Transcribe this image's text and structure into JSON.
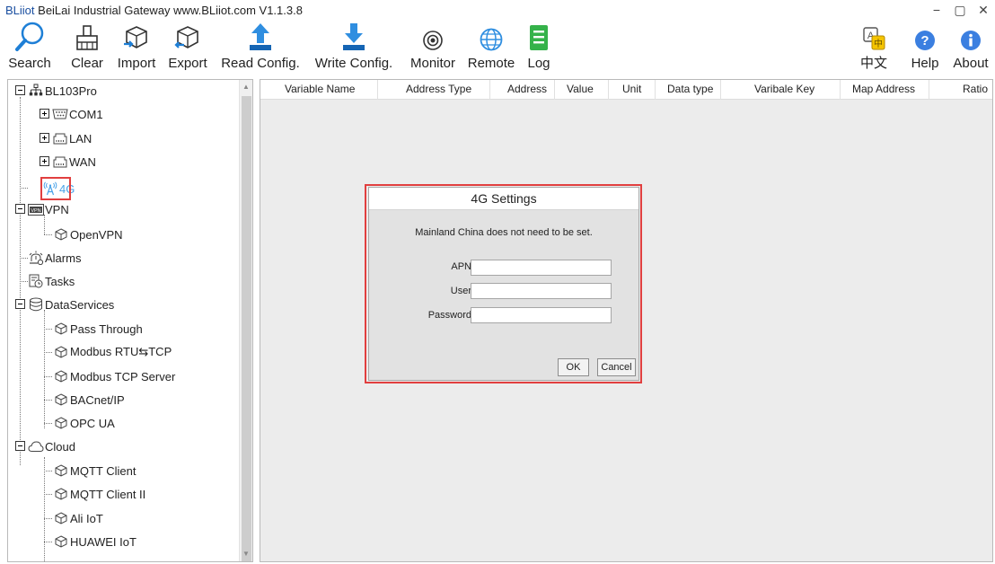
{
  "window": {
    "brand": "BLiiot",
    "title": " BeiLai Industrial Gateway www.BLiiot.com V1.1.3.8",
    "minimize": "−",
    "maximize": "▢",
    "close": "✕"
  },
  "toolbar": {
    "search": "Search",
    "clear": "Clear",
    "import": "Import",
    "export": "Export",
    "read_config": "Read Config.",
    "write_config": "Write Config.",
    "monitor": "Monitor",
    "remote": "Remote",
    "log": "Log",
    "language": "中文",
    "help": "Help",
    "about": "About"
  },
  "tree": {
    "root": "BL103Pro",
    "com1": "COM1",
    "lan": "LAN",
    "wan": "WAN",
    "g4": "4G",
    "vpn": "VPN",
    "openvpn": "OpenVPN",
    "alarms": "Alarms",
    "tasks": "Tasks",
    "data_services": "DataServices",
    "pass_through": "Pass Through",
    "modbus_rtu_tcp": "Modbus RTU⇆TCP",
    "modbus_tcp_server": "Modbus TCP Server",
    "bacnet_ip": "BACnet/IP",
    "opc_ua": "OPC UA",
    "cloud": "Cloud",
    "mqtt_client": "MQTT Client",
    "mqtt_client_2": "MQTT Client II",
    "ali_iot": "Ali IoT",
    "huawei_iot": "HUAWEI IoT"
  },
  "table": {
    "columns": [
      "Variable Name",
      "Address Type",
      "Address",
      "Value",
      "Unit",
      "Data type",
      "Varibale Key",
      "Map Address",
      "Ratio"
    ]
  },
  "dialog": {
    "title": "4G Settings",
    "note": "Mainland China does not need to be set.",
    "apn_label": "APN",
    "apn_value": "",
    "user_label": "User",
    "user_value": "",
    "password_label": "Password",
    "password_value": "",
    "ok": "OK",
    "cancel": "Cancel"
  },
  "colors": {
    "icon_blue": "#1e7fd6",
    "highlight_red": "#e13f3f",
    "active_4g": "#4aa3e8"
  }
}
